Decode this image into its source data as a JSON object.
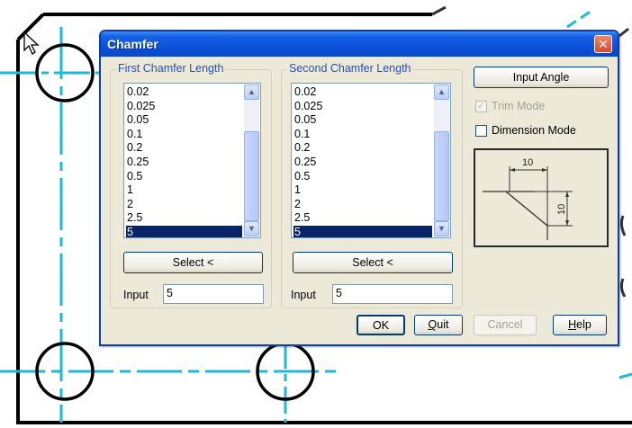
{
  "dialog": {
    "title": "Chamfer",
    "close_glyph": "✕"
  },
  "first_group": {
    "title": "First Chamfer Length",
    "items": [
      "0.02",
      "0.025",
      "0.05",
      "0.1",
      "0.2",
      "0.25",
      "0.5",
      "1",
      "2",
      "2.5",
      "5"
    ],
    "selected": "5",
    "select_button": "Select <",
    "input_label": "Input",
    "input_value": "5"
  },
  "second_group": {
    "title": "Second Chamfer Length",
    "items": [
      "0.02",
      "0.025",
      "0.05",
      "0.1",
      "0.2",
      "0.25",
      "0.5",
      "1",
      "2",
      "2.5",
      "5"
    ],
    "selected": "5",
    "select_button": "Select <",
    "input_label": "Input",
    "input_value": "5"
  },
  "right_panel": {
    "input_angle_button": "Input Angle",
    "trim_mode_label": "Trim Mode",
    "trim_mode_checked": true,
    "dimension_mode_label": "Dimension Mode",
    "dimension_mode_checked": false,
    "preview": {
      "dim_top": "10",
      "dim_right": "10"
    }
  },
  "buttons": {
    "ok": "OK",
    "quit_first": "Q",
    "quit_rest": "uit",
    "cancel": "Cancel",
    "help_first": "H",
    "help_rest": "elp"
  },
  "colors": {
    "title_bar": "#0a4fd6",
    "dialog_bg": "#ece9d8",
    "group_title": "#1f50d0",
    "selection": "#0a246a",
    "cad_lines": "#000000",
    "center_lines": "#20b8d8"
  }
}
